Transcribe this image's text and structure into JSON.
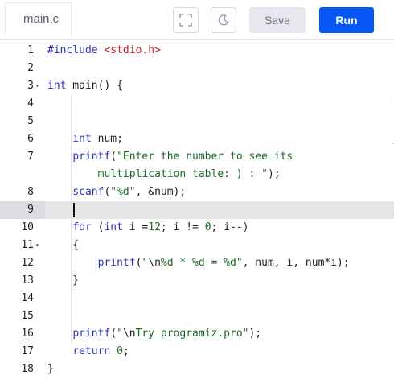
{
  "file_tab": {
    "label": "main.c"
  },
  "toolbar": {
    "fullscreen_icon": "fullscreen-icon",
    "theme_icon": "moon-icon",
    "save_label": "Save",
    "run_label": "Run"
  },
  "editor": {
    "active_line": 9,
    "lines": [
      {
        "n": "1",
        "tokens": [
          [
            "kw",
            "#include"
          ],
          [
            "t",
            " "
          ],
          [
            "inc",
            "<stdio.h>"
          ]
        ]
      },
      {
        "n": "2",
        "tokens": []
      },
      {
        "n": "3",
        "fold": true,
        "tokens": [
          [
            "kw",
            "int"
          ],
          [
            "t",
            " main() {"
          ]
        ]
      },
      {
        "n": "4",
        "tokens": []
      },
      {
        "n": "5",
        "tokens": []
      },
      {
        "n": "6",
        "tokens": [
          [
            "t",
            "    "
          ],
          [
            "kw",
            "int"
          ],
          [
            "t",
            " num;"
          ]
        ]
      },
      {
        "n": "7",
        "tokens": [
          [
            "t",
            "    "
          ],
          [
            "kw",
            "printf"
          ],
          [
            "t",
            "("
          ],
          [
            "str",
            "\"Enter the number to see its"
          ]
        ]
      },
      {
        "n": "",
        "tokens": [
          [
            "t",
            "        "
          ],
          [
            "str",
            "multiplication table: ) : \""
          ],
          [
            "t",
            ");"
          ]
        ]
      },
      {
        "n": "8",
        "tokens": [
          [
            "t",
            "    "
          ],
          [
            "kw",
            "scanf"
          ],
          [
            "t",
            "("
          ],
          [
            "str",
            "\"%d\""
          ],
          [
            "t",
            ", &num);"
          ]
        ]
      },
      {
        "n": "9",
        "tokens": []
      },
      {
        "n": "10",
        "tokens": [
          [
            "t",
            "    "
          ],
          [
            "kw",
            "for"
          ],
          [
            "t",
            " ("
          ],
          [
            "kw",
            "int"
          ],
          [
            "t",
            " i ="
          ],
          [
            "num",
            "12"
          ],
          [
            "t",
            "; i != "
          ],
          [
            "num",
            "0"
          ],
          [
            "t",
            "; i--)"
          ]
        ]
      },
      {
        "n": "11",
        "fold": true,
        "tokens": [
          [
            "t",
            "    {"
          ]
        ]
      },
      {
        "n": "12",
        "tokens": [
          [
            "t",
            "        "
          ],
          [
            "kw",
            "printf"
          ],
          [
            "t",
            "("
          ],
          [
            "str",
            "\""
          ],
          [
            "esc",
            "\\n"
          ],
          [
            "str",
            "%d * %d = %d\""
          ],
          [
            "t",
            ", num, i, num*i);"
          ]
        ]
      },
      {
        "n": "13",
        "tokens": [
          [
            "t",
            "    }"
          ]
        ]
      },
      {
        "n": "14",
        "tokens": []
      },
      {
        "n": "15",
        "tokens": []
      },
      {
        "n": "16",
        "tokens": [
          [
            "t",
            "    "
          ],
          [
            "kw",
            "printf"
          ],
          [
            "t",
            "("
          ],
          [
            "str",
            "\""
          ],
          [
            "esc",
            "\\n"
          ],
          [
            "str",
            "Try programiz.pro\""
          ],
          [
            "t",
            ");"
          ]
        ]
      },
      {
        "n": "17",
        "tokens": [
          [
            "t",
            "    "
          ],
          [
            "kw",
            "return"
          ],
          [
            "t",
            " "
          ],
          [
            "num",
            "0"
          ],
          [
            "t",
            ";"
          ]
        ]
      },
      {
        "n": "18",
        "tokens": [
          [
            "t",
            "}"
          ]
        ]
      }
    ]
  },
  "colors": {
    "run_button": "#0556f3",
    "save_button": "#e7e8ee",
    "keyword": "#2b33b3",
    "string": "#1b6a27",
    "include": "#c31e2d"
  }
}
